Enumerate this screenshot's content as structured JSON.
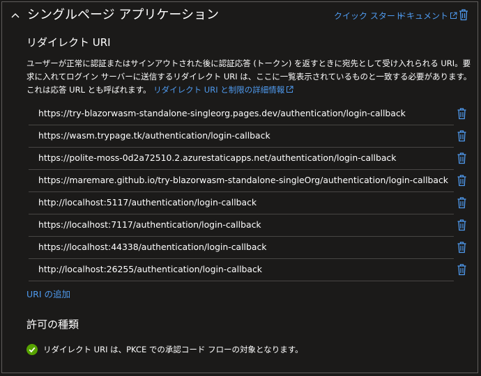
{
  "header": {
    "title": "シングルページ アプリケーション",
    "quickstart_label": "クイック スタート",
    "docs_label": "ドキュメント"
  },
  "redirect": {
    "title": "リダイレクト URI",
    "description": "ユーザーが正常に認証またはサインアウトされた後に認証応答 (トークン) を返すときに宛先として受け入れられる URI。要求に入れてログイン サーバーに送信するリダイレクト URI は、ここに一覧表示されているものと一致する必要があります。これは応答 URL とも呼ばれます。",
    "learn_more_link": "リダイレクト URI と制限の詳細情報",
    "uris": [
      "https://try-blazorwasm-standalone-singleorg.pages.dev/authentication/login-callback",
      "https://wasm.trypage.tk/authentication/login-callback",
      "https://polite-moss-0d2a72510.2.azurestaticapps.net/authentication/login-callback",
      "https://maremare.github.io/try-blazorwasm-standalone-singleOrg/authentication/login-callback",
      "http://localhost:5117/authentication/login-callback",
      "https://localhost:7117/authentication/login-callback",
      "https://localhost:44338/authentication/login-callback",
      "http://localhost:26255/authentication/login-callback"
    ],
    "add_uri_label": "URI の追加"
  },
  "grant": {
    "title": "許可の種類",
    "message": "リダイレクト URI は、PKCE での承認コード フローの対象となります。"
  },
  "colors": {
    "background": "#1b1a19",
    "link": "#4f9bf0",
    "border": "#605e5c",
    "success": "#57a300"
  }
}
